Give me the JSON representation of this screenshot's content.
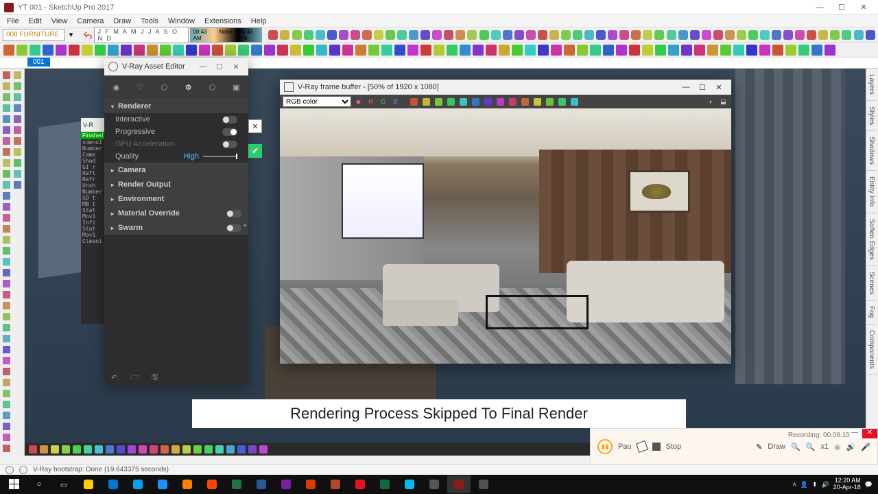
{
  "window": {
    "title": "YT 001 - SketchUp Pro 2017",
    "min": "—",
    "max": "☐",
    "close": "✕"
  },
  "menus": [
    "File",
    "Edit",
    "View",
    "Camera",
    "Draw",
    "Tools",
    "Window",
    "Extensions",
    "Help"
  ],
  "layer_dropdown": "008 FURNITURE",
  "months": "J F M A M J J A S O N D",
  "times": {
    "a": "08:43 AM",
    "b": "Noon",
    "c": "04:46 PM"
  },
  "scene_tab": "001",
  "trays": [
    "Layers",
    "Styles",
    "Shadows",
    "Entity Info",
    "Soften Edges",
    "Scenes",
    "Fog",
    "Components"
  ],
  "vray_editor": {
    "title": "V-Ray Asset Editor",
    "sections": {
      "renderer": "Renderer",
      "interactive": "Interactive",
      "progressive": "Progressive",
      "gpu": "GPU Acceleration",
      "quality": "Quality",
      "quality_val": "High",
      "camera": "Camera",
      "render_output": "Render Output",
      "environment": "Environment",
      "material_override": "Material Override",
      "swarm": "Swarm"
    }
  },
  "vlog": {
    "header": "V-R",
    "status": "Finished",
    "lines": [
      "vdeno1",
      "Number",
      "Came",
      "Shad",
      "GI r",
      "Refl",
      "Refr",
      "Unsh",
      "Number",
      "SD t",
      "MB t",
      "Stat",
      "Mov1",
      "Infi",
      "Stat",
      "Mov1",
      "Cleani"
    ]
  },
  "vfb": {
    "title": "V-Ray frame buffer - [50% of 1920 x 1080]",
    "channel": "RGB color",
    "rgb": [
      "R",
      "G",
      "B"
    ]
  },
  "caption": "Rendering Process Skipped To Final Render",
  "recorder": {
    "recording": "Recording:   00.08.15",
    "pause": "Pau",
    "stop": "Stop",
    "draw": "Draw",
    "zoom": "x1"
  },
  "statusbar": "V-Ray bootstrap: Done (19.643375 seconds)",
  "tray": {
    "time": "12:20 AM",
    "date": "20-Apr-18"
  }
}
